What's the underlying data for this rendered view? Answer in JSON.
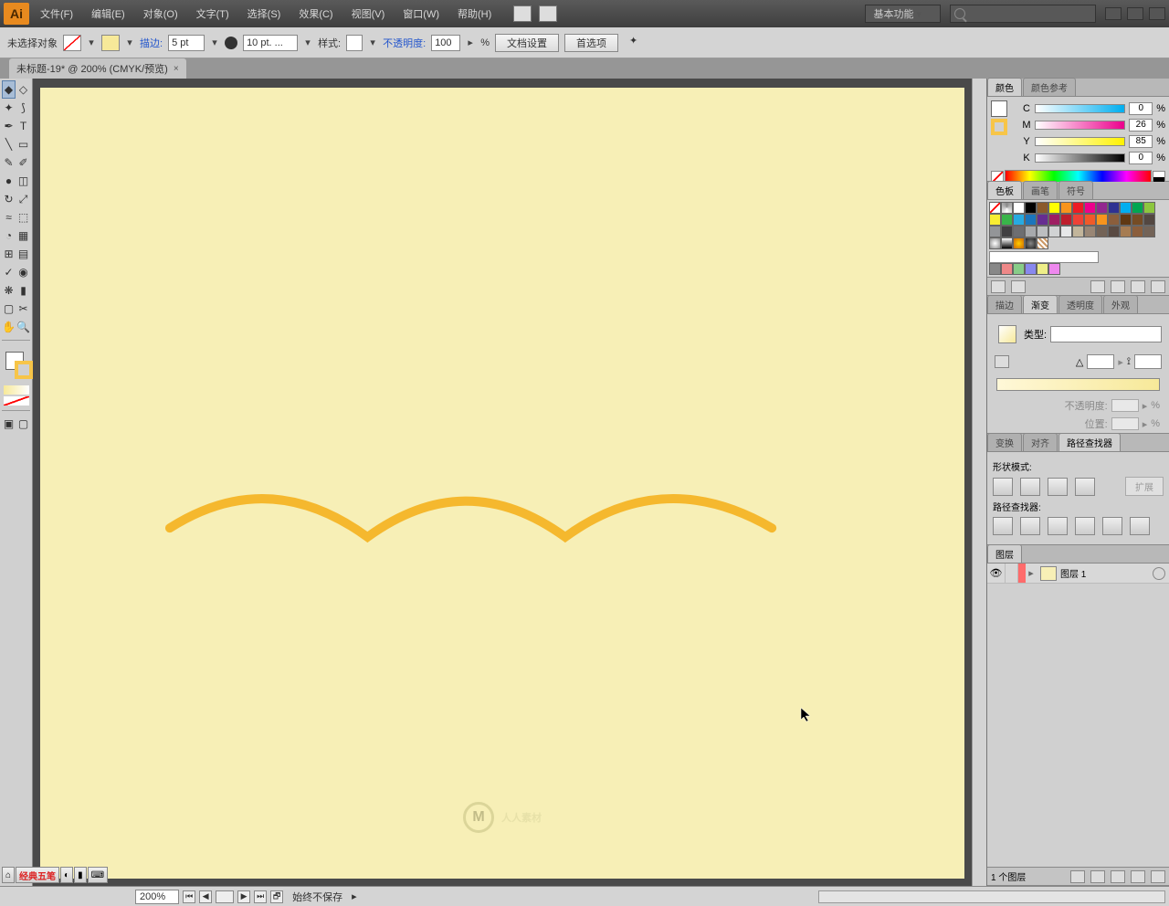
{
  "app": {
    "logo_text": "Ai"
  },
  "menu": [
    "文件(F)",
    "编辑(E)",
    "对象(O)",
    "文字(T)",
    "选择(S)",
    "效果(C)",
    "视图(V)",
    "窗口(W)",
    "帮助(H)"
  ],
  "workspace": "基本功能",
  "control": {
    "no_selection": "未选择对象",
    "stroke_label": "描边:",
    "stroke_value": "5 pt",
    "brush_value": "10 pt. ...",
    "style_label": "样式:",
    "opacity_label": "不透明度:",
    "opacity_value": "100",
    "opacity_unit": "%",
    "doc_setup": "文档设置",
    "prefs": "首选项"
  },
  "doc_tab": "未标题-19* @ 200% (CMYK/预览)",
  "color": {
    "tab1": "颜色",
    "tab2": "颜色参考",
    "c_label": "C",
    "c_value": "0",
    "m_label": "M",
    "m_value": "26",
    "y_label": "Y",
    "y_value": "85",
    "k_label": "K",
    "k_value": "0",
    "pct": "%"
  },
  "swatches": {
    "tab1": "色板",
    "tab2": "画笔",
    "tab3": "符号"
  },
  "gradient": {
    "tab1": "描边",
    "tab2": "渐变",
    "tab3": "透明度",
    "tab4": "外观",
    "type_label": "类型:",
    "opacity_label": "不透明度:",
    "position_label": "位置:",
    "pct": "%"
  },
  "pathfinder": {
    "tab1": "变换",
    "tab2": "对齐",
    "tab3": "路径查找器",
    "shape_mode": "形状模式:",
    "expand": "扩展",
    "pf_label": "路径查找器:"
  },
  "layers": {
    "tab": "图层",
    "layer1": "图层 1",
    "footer": "1 个图层"
  },
  "status": {
    "zoom": "200%",
    "save_text": "始终不保存"
  },
  "ime": {
    "text": "经典五笔"
  },
  "watermark": "人人素材"
}
